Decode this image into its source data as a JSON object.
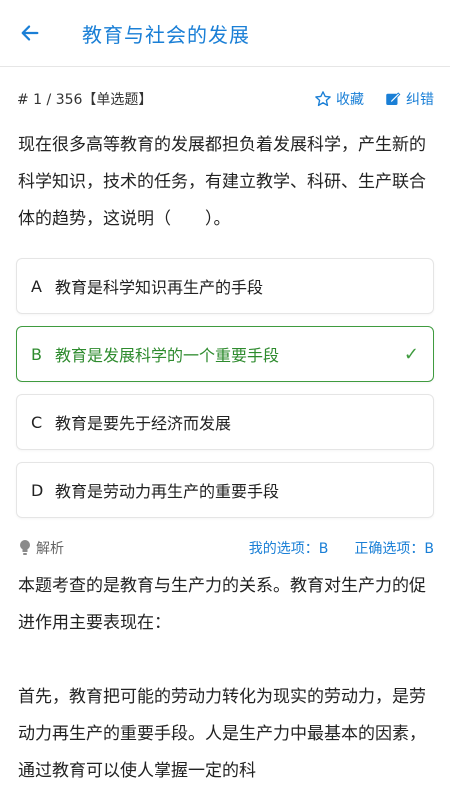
{
  "header": {
    "title": "教育与社会的发展"
  },
  "meta": {
    "question_number": "# 1 / 356【单选题】",
    "favorite_label": "收藏",
    "correct_label": "纠错"
  },
  "question": {
    "text": "现在很多高等教育的发展都担负着发展科学，产生新的科学知识，技术的任务，有建立教学、科研、生产联合体的趋势，这说明（　　）。"
  },
  "options": [
    {
      "key": "A",
      "text": "教育是科学知识再生产的手段"
    },
    {
      "key": "B",
      "text": "教育是发展科学的一个重要手段"
    },
    {
      "key": "C",
      "text": "教育是要先于经济而发展"
    },
    {
      "key": "D",
      "text": "教育是劳动力再生产的重要手段"
    }
  ],
  "analysis": {
    "label": "解析",
    "my_answer": "我的选项：B",
    "correct_answer": "正确选项：B",
    "paragraphs": [
      "本题考查的是教育与生产力的关系。教育对生产力的促进作用主要表现在：",
      " 首先，教育把可能的劳动力转化为现实的劳动力，是劳动力再生产的重要手段。人是生产力中最基本的因素，通过教育可以使人掌握一定的科"
    ]
  },
  "colors": {
    "accent": "#1a7fd6",
    "correct": "#3f9b3f"
  }
}
